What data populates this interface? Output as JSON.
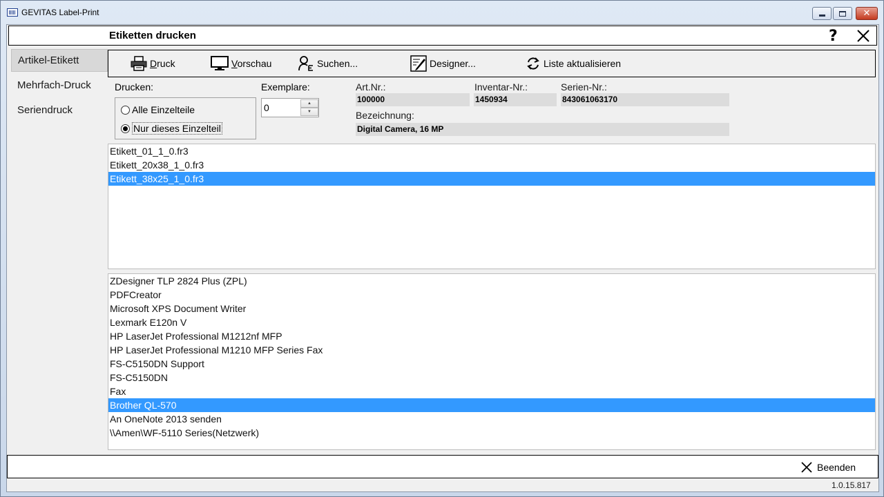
{
  "window": {
    "title": "GEVITAS Label-Print"
  },
  "header": {
    "title": "Etiketten drucken",
    "help": "?"
  },
  "sidebar": {
    "items": [
      {
        "label": "Artikel-Etikett"
      },
      {
        "label": "Mehrfach-Druck"
      },
      {
        "label": "Seriendruck"
      }
    ]
  },
  "toolbar": {
    "druck_key": "D",
    "druck_rest": "ruck",
    "vorschau_key": "V",
    "vorschau_rest": "orschau",
    "suchen": "Suchen...",
    "designer": "Designer...",
    "refresh": "Liste aktualisieren"
  },
  "options": {
    "drucken_label": "Drucken:",
    "radio_all": "Alle Einzelteile",
    "radio_single": "Nur dieses Einzelteil",
    "exemplare_label": "Exemplare:",
    "exemplare_value": "0"
  },
  "article": {
    "artnr_label": "Art.Nr.:",
    "artnr_value": "100000",
    "inventar_label": "Inventar-Nr.:",
    "inventar_value": "1450934",
    "serien_label": "Serien-Nr.:",
    "serien_value": "843061063170",
    "bezeichnung_label": "Bezeichnung:",
    "bezeichnung_value": "Digital Camera, 16 MP"
  },
  "label_files": [
    "Etikett_01_1_0.fr3",
    "Etikett_20x38_1_0.fr3",
    "Etikett_38x25_1_0.fr3"
  ],
  "printers": [
    "ZDesigner TLP 2824 Plus (ZPL)",
    "PDFCreator",
    "Microsoft XPS Document Writer",
    "Lexmark E120n V",
    "HP LaserJet Professional M1212nf MFP",
    "HP LaserJet Professional M1210 MFP Series Fax",
    "FS-C5150DN Support",
    "FS-C5150DN",
    "Fax",
    "Brother QL-570",
    "An OneNote 2013 senden",
    "\\\\Amen\\WF-5110 Series(Netzwerk)"
  ],
  "footer": {
    "beenden": "Beenden",
    "version": "1.0.15.817"
  },
  "colors": {
    "selection": "#3399ff"
  }
}
